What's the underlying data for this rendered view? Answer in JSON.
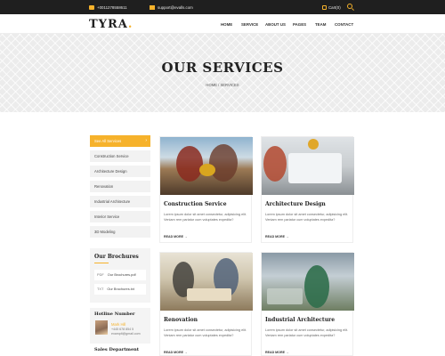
{
  "topbar": {
    "phone": "+0011278558611",
    "email": "support@evalls.com",
    "cart": "Cart(0)"
  },
  "header": {
    "logo": "TYRA",
    "logo_dot": ".",
    "nav": [
      "HOME",
      "SERVICE",
      "ABOUT US",
      "PAGES",
      "TEAM",
      "CONTACT"
    ]
  },
  "banner": {
    "title": "OUR SERVICES",
    "breadcrumb": "HOME  /  SERVICES"
  },
  "sidebar": {
    "menu": [
      "See All Services",
      "Construction Service",
      "Architecture Design",
      "Renovation",
      "Industrial Architecture",
      "Interior Service",
      "3D Modeling"
    ],
    "active_arrow": "›",
    "brochures_title": "Our Brochures",
    "brochures": [
      {
        "type": "PDF",
        "name": "Our Brochures.pdf"
      },
      {
        "type": "TXT",
        "name": "Our Brochures.txt"
      }
    ],
    "hotline_title": "Hotline Number",
    "contact_name": "Mark Hill",
    "contact_phone": "+445 678 854 5",
    "contact_email": "examplt@gmail.com",
    "sales_title": "Sales Department"
  },
  "services": [
    {
      "title": "Construction Service",
      "text": "Lorem ipsum dolor sit amet consectetur, adipisicing elit. Veniam rem pariatur cum voluptates expedita?",
      "more": "READ MORE →"
    },
    {
      "title": "Architecture Design",
      "text": "Lorem ipsum dolor sit amet consectetur, adipisicing elit. Veniam rem pariatur cum voluptates expedita?",
      "more": "READ MORE →"
    },
    {
      "title": "Renovation",
      "text": "Lorem ipsum dolor sit amet consectetur, adipisicing elit. Veniam rem pariatur cum voluptates expedita?",
      "more": "READ MORE →"
    },
    {
      "title": "Industrial Architecture",
      "text": "Lorem ipsum dolor sit amet consectetur, adipisicing elit. Veniam rem pariatur cum voluptates expedita?",
      "more": "READ MORE →"
    }
  ],
  "colors": {
    "accent": "#f6b22b",
    "topbar": "#1f1f1f"
  },
  "icons": {
    "phone": "phone-icon",
    "email": "mail-icon",
    "cart": "cart-icon",
    "search": "search-icon"
  }
}
